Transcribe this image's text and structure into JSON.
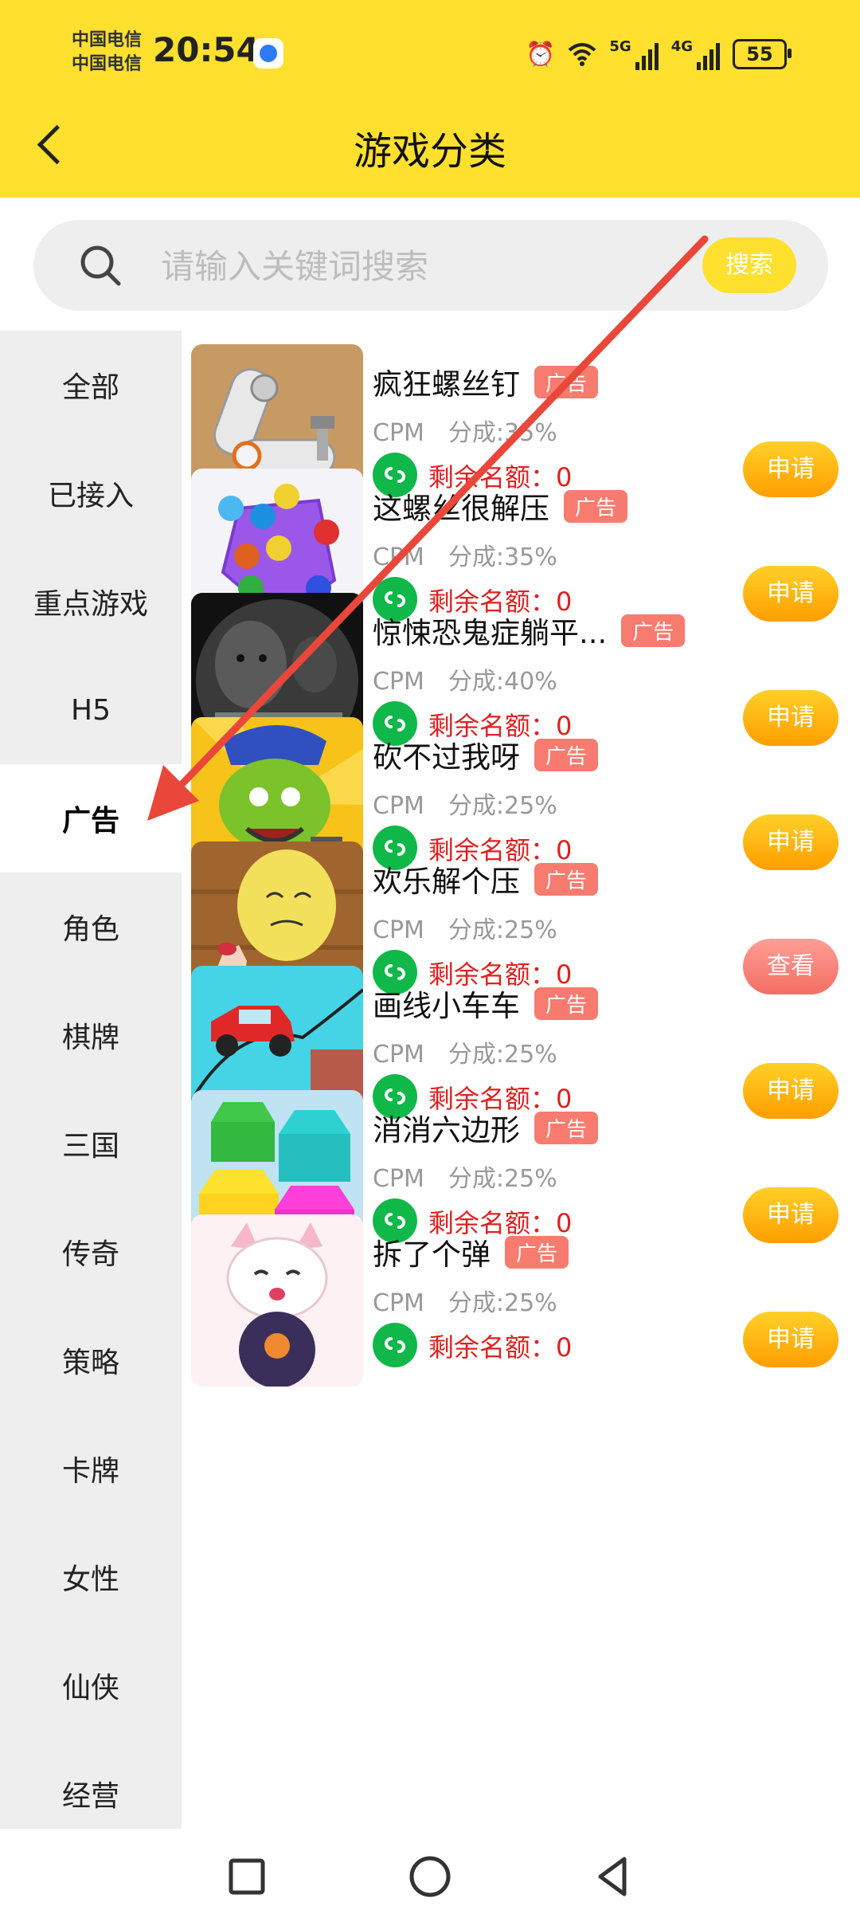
{
  "status_bar": {
    "carrier1": "中国电信",
    "carrier2": "中国电信",
    "time": "20:54",
    "net1": "5G",
    "net2": "4G",
    "battery": "55"
  },
  "header": {
    "title": "游戏分类"
  },
  "search": {
    "placeholder": "请输入关键词搜索",
    "button": "搜索"
  },
  "sidebar": {
    "items": [
      {
        "label": "全部"
      },
      {
        "label": "已接入"
      },
      {
        "label": "重点游戏"
      },
      {
        "label": "H5"
      },
      {
        "label": "广告"
      },
      {
        "label": "角色"
      },
      {
        "label": "棋牌"
      },
      {
        "label": "三国"
      },
      {
        "label": "传奇"
      },
      {
        "label": "策略"
      },
      {
        "label": "卡牌"
      },
      {
        "label": "女性"
      },
      {
        "label": "仙侠"
      },
      {
        "label": "经营"
      }
    ],
    "active": "广告"
  },
  "games": [
    {
      "name": "疯狂螺丝钉",
      "badge": "广告",
      "cpm": "CPM",
      "share": "分成:35%",
      "remain": "剩余名额：0",
      "action": "申请"
    },
    {
      "name": "这螺丝很解压",
      "badge": "广告",
      "cpm": "CPM",
      "share": "分成:35%",
      "remain": "剩余名额：0",
      "action": "申请"
    },
    {
      "name": "惊悚恐鬼症躺平...",
      "badge": "广告",
      "cpm": "CPM",
      "share": "分成:40%",
      "remain": "剩余名额：0",
      "action": "申请"
    },
    {
      "name": "砍不过我呀",
      "badge": "广告",
      "cpm": "CPM",
      "share": "分成:25%",
      "remain": "剩余名额：0",
      "action": "申请"
    },
    {
      "name": "欢乐解个压",
      "badge": "广告",
      "cpm": "CPM",
      "share": "分成:25%",
      "remain": "剩余名额：0",
      "action": "查看"
    },
    {
      "name": "画线小车车",
      "badge": "广告",
      "cpm": "CPM",
      "share": "分成:25%",
      "remain": "剩余名额：0",
      "action": "申请"
    },
    {
      "name": "消消六边形",
      "badge": "广告",
      "cpm": "CPM",
      "share": "分成:25%",
      "remain": "剩余名额：0",
      "action": "申请"
    },
    {
      "name": "拆了个弹",
      "badge": "广告",
      "cpm": "CPM",
      "share": "分成:25%",
      "remain": "剩余名额：0",
      "action": "申请"
    }
  ],
  "colors": {
    "accent": "#FFE02E",
    "ad_badge": "#F77B6E",
    "remain_text": "#E02020",
    "wechat_green": "#10B84A"
  }
}
